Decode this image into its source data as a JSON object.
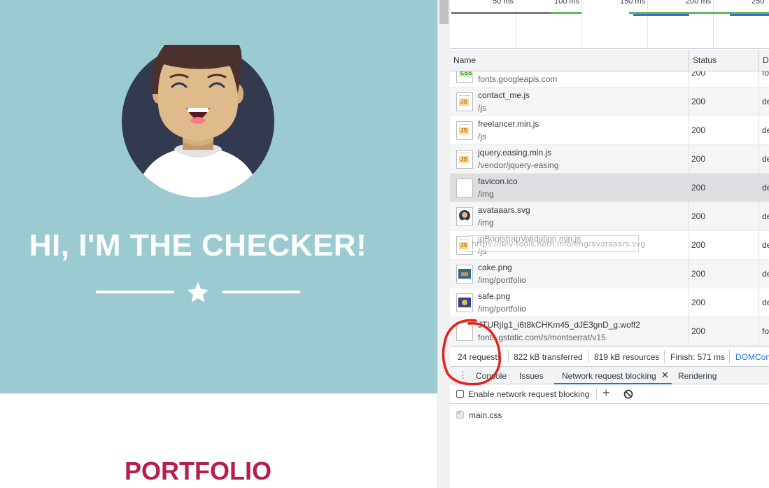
{
  "page": {
    "hero_title": "HI, I'M THE CHECKER!",
    "portfolio_title": "PORTFOLIO",
    "colors": {
      "hero_bg": "#9bcbd1",
      "avatar_bg": "#33394f",
      "accent": "#b5204a"
    }
  },
  "devtools": {
    "overview": {
      "ticks": [
        "50 ms",
        "100 ms",
        "150 ms",
        "200 ms",
        "250"
      ]
    },
    "columns": {
      "name": "Name",
      "status": "Status",
      "domain": "Do"
    },
    "requests": [
      {
        "name": "",
        "path": "fonts.googleapis.com",
        "status": "200",
        "domain": "fo",
        "icon": "css-file-icon"
      },
      {
        "name": "contact_me.js",
        "path": "/js",
        "status": "200",
        "domain": "de",
        "icon": "js-file-icon"
      },
      {
        "name": "freelancer.min.js",
        "path": "/js",
        "status": "200",
        "domain": "de",
        "icon": "js-file-icon"
      },
      {
        "name": "jquery.easing.min.js",
        "path": "/vendor/jquery-easing",
        "status": "200",
        "domain": "de",
        "icon": "js-file-icon"
      },
      {
        "name": "favicon.ico",
        "path": "/img",
        "status": "200",
        "domain": "de",
        "icon": "blank-file-icon"
      },
      {
        "name": "avataaars.svg",
        "path": "/img",
        "status": "200",
        "domain": "de",
        "icon": "avatar-thumbnail-icon"
      },
      {
        "name": "jqBootstrapValidation.min.js",
        "path": "/js",
        "status": "200",
        "domain": "de",
        "icon": "js-file-icon"
      },
      {
        "name": "cake.png",
        "path": "/img/portfolio",
        "status": "200",
        "domain": "de",
        "icon": "cake-thumbnail-icon"
      },
      {
        "name": "safe.png",
        "path": "/img/portfolio",
        "status": "200",
        "domain": "de",
        "icon": "safe-thumbnail-icon"
      },
      {
        "name": "JTURjIg1_i6t8kCHKm45_dJE3gnD_g.woff2",
        "path": "fonts.gstatic.com/s/montserrat/v15",
        "status": "200",
        "domain": "fo",
        "icon": "font-file-icon"
      }
    ],
    "tooltip": "https://dev-tools.hoth.info/img/avataaars.svg",
    "summary": {
      "requests": "24 requests",
      "transferred": "822 kB transferred",
      "resources": "819 kB resources",
      "finish": "Finish: 571 ms",
      "domcontent": "DOMCon"
    },
    "drawer": {
      "tabs": [
        "Console",
        "Issues",
        "Network request blocking",
        "Rendering"
      ],
      "active_tab": "Network request blocking",
      "enable_label": "Enable network request blocking",
      "enable_checked": false,
      "patterns": [
        {
          "label": "main.css",
          "checked": true
        }
      ]
    }
  }
}
